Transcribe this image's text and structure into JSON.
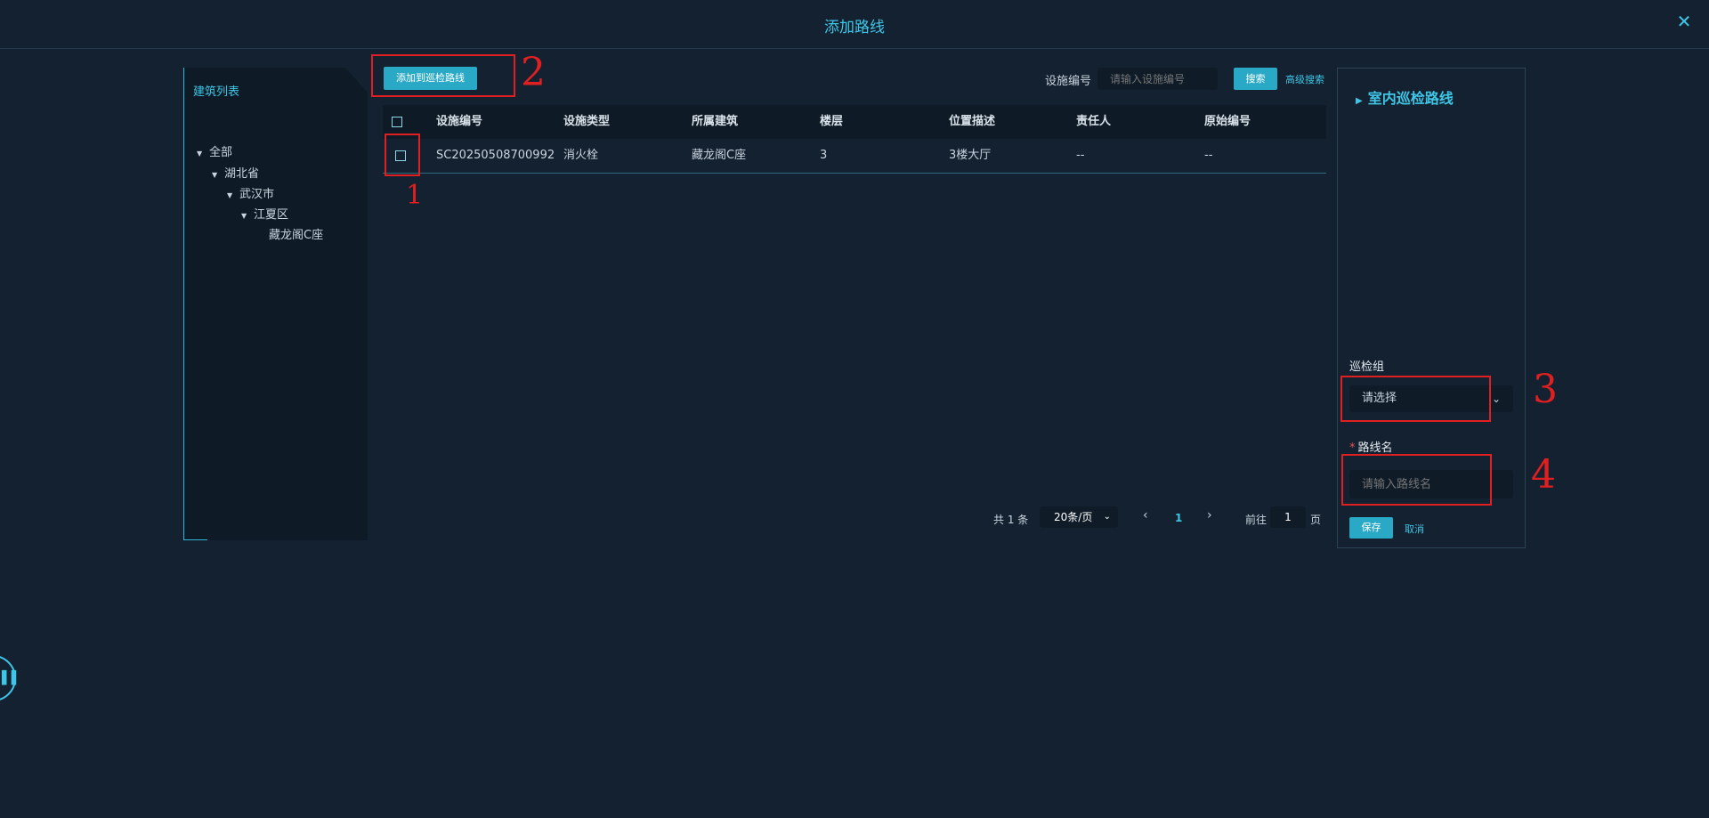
{
  "header": {
    "title": "添加路线",
    "close_glyph": "✕"
  },
  "tree": {
    "title": "建筑列表",
    "nodes": [
      {
        "label": "全部"
      },
      {
        "label": "湖北省"
      },
      {
        "label": "武汉市"
      },
      {
        "label": "江夏区"
      },
      {
        "label": "藏龙阁C座"
      }
    ]
  },
  "toolbar": {
    "add_button": "添加到巡检路线",
    "search_label": "设施编号",
    "search_placeholder": "请输入设施编号",
    "search_button": "搜索",
    "advanced_search": "高级搜索"
  },
  "table": {
    "headers": [
      "设施编号",
      "设施类型",
      "所属建筑",
      "楼层",
      "位置描述",
      "责任人",
      "原始编号"
    ],
    "rows": [
      [
        "SC20250508700992",
        "消火栓",
        "藏龙阁C座",
        "3",
        "3楼大厅",
        "--",
        "--"
      ]
    ]
  },
  "pagination": {
    "total": "共 1 条",
    "page_size": "20条/页",
    "current_page": "1",
    "goto_prefix": "前往",
    "goto_value": "1",
    "goto_suffix": "页"
  },
  "right_panel": {
    "title": "室内巡检路线",
    "group_label": "巡检组",
    "group_placeholder": "请选择",
    "route_label": "路线名",
    "route_placeholder": "请输入路线名",
    "save_button": "保存",
    "cancel_button": "取消"
  },
  "annotations": [
    "1",
    "2",
    "3",
    "4"
  ],
  "colors": {
    "accent": "#3fc6e6",
    "button": "#2aa9c6",
    "highlight": "#e02020",
    "background": "#132130"
  }
}
